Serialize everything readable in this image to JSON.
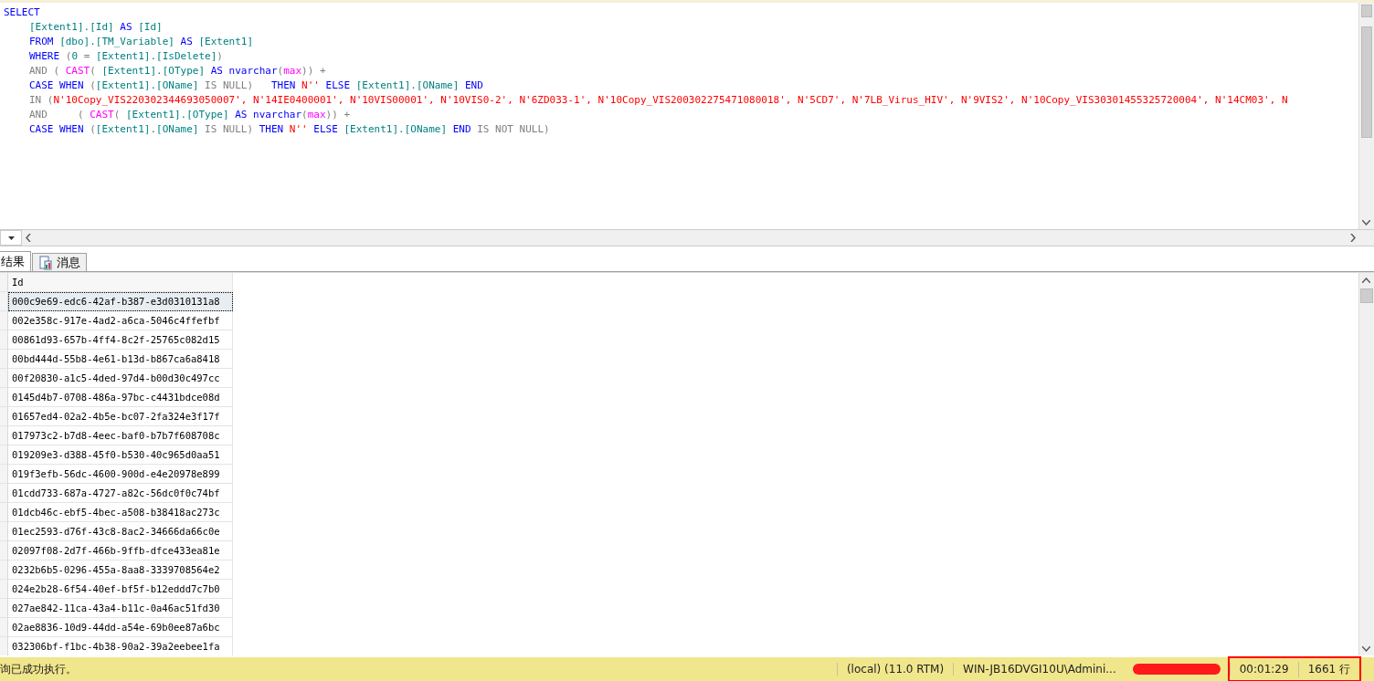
{
  "editor": {
    "lines": [
      {
        "tokens": [
          {
            "kind": "keyword",
            "text": "SELECT"
          }
        ]
      },
      {
        "tokens": [
          {
            "kind": "ident",
            "text": "[Extent1].[Id]"
          },
          {
            "kind": "keyword",
            "text": " AS "
          },
          {
            "kind": "ident",
            "text": "[Id]"
          }
        ]
      },
      {
        "tokens": [
          {
            "kind": "keyword",
            "text": "FROM "
          },
          {
            "kind": "ident",
            "text": "[dbo].[TM_Variable]"
          },
          {
            "kind": "keyword",
            "text": " AS "
          },
          {
            "kind": "ident",
            "text": "[Extent1]"
          }
        ]
      },
      {
        "tokens": [
          {
            "kind": "keyword",
            "text": "WHERE "
          },
          {
            "kind": "op",
            "text": "("
          },
          {
            "kind": "ident",
            "text": "0 "
          },
          {
            "kind": "op",
            "text": "= "
          },
          {
            "kind": "ident",
            "text": "[Extent1].[IsDelete]"
          },
          {
            "kind": "op",
            "text": ")"
          }
        ]
      },
      {
        "tokens": [
          {
            "kind": "op",
            "text": "AND ( "
          },
          {
            "kind": "func",
            "text": "CAST"
          },
          {
            "kind": "op",
            "text": "( "
          },
          {
            "kind": "ident",
            "text": "[Extent1].[OType]"
          },
          {
            "kind": "keyword",
            "text": " AS nvarchar"
          },
          {
            "kind": "op",
            "text": "("
          },
          {
            "kind": "func",
            "text": "max"
          },
          {
            "kind": "op",
            "text": ")) +"
          }
        ]
      },
      {
        "tokens": [
          {
            "kind": "keyword",
            "text": "CASE WHEN "
          },
          {
            "kind": "op",
            "text": "("
          },
          {
            "kind": "ident",
            "text": "[Extent1].[OName]"
          },
          {
            "kind": "op",
            "text": " IS NULL)   "
          },
          {
            "kind": "keyword",
            "text": "THEN "
          },
          {
            "kind": "string",
            "text": "N''"
          },
          {
            "kind": "keyword",
            "text": " ELSE "
          },
          {
            "kind": "ident",
            "text": "[Extent1].[OName]"
          },
          {
            "kind": "keyword",
            "text": " END"
          }
        ]
      },
      {
        "tokens": [
          {
            "kind": "op",
            "text": "IN ("
          },
          {
            "kind": "string",
            "text": "N'10Copy_VIS220302344693050007', N'14IE0400001', N'10VIS00001', N'10VIS0-2', N'6ZD033-1', N'10Copy_VIS200302275471080018', N'5CD7', N'7LB_Virus_HIV', N'9VIS2', N'10Copy_VIS30301455325720004', N'14CM03', N"
          }
        ]
      },
      {
        "tokens": [
          {
            "kind": "op",
            "text": "AND     ( "
          },
          {
            "kind": "func",
            "text": "CAST"
          },
          {
            "kind": "op",
            "text": "( "
          },
          {
            "kind": "ident",
            "text": "[Extent1].[OType]"
          },
          {
            "kind": "keyword",
            "text": " AS nvarchar"
          },
          {
            "kind": "op",
            "text": "("
          },
          {
            "kind": "func",
            "text": "max"
          },
          {
            "kind": "op",
            "text": ")) +"
          }
        ]
      },
      {
        "tokens": [
          {
            "kind": "keyword",
            "text": "CASE WHEN "
          },
          {
            "kind": "op",
            "text": "("
          },
          {
            "kind": "ident",
            "text": "[Extent1].[OName]"
          },
          {
            "kind": "op",
            "text": " IS NULL) "
          },
          {
            "kind": "keyword",
            "text": "THEN "
          },
          {
            "kind": "string",
            "text": "N''"
          },
          {
            "kind": "keyword",
            "text": " ELSE "
          },
          {
            "kind": "ident",
            "text": "[Extent1].[OName]"
          },
          {
            "kind": "keyword",
            "text": " END "
          },
          {
            "kind": "op",
            "text": "IS NOT NULL)"
          }
        ]
      }
    ]
  },
  "result_tabs": [
    {
      "label": "结果",
      "selected": true
    },
    {
      "label": "消息",
      "selected": false
    }
  ],
  "grid": {
    "columns": [
      "Id"
    ],
    "rows": [
      {
        "cells": [
          "000c9e69-edc6-42af-b387-e3d0310131a8"
        ],
        "selected": true
      },
      {
        "cells": [
          "002e358c-917e-4ad2-a6ca-5046c4ffefbf"
        ],
        "selected": false
      },
      {
        "cells": [
          "00861d93-657b-4ff4-8c2f-25765c082d15"
        ],
        "selected": false
      },
      {
        "cells": [
          "00bd444d-55b8-4e61-b13d-b867ca6a8418"
        ],
        "selected": false
      },
      {
        "cells": [
          "00f20830-a1c5-4ded-97d4-b00d30c497cc"
        ],
        "selected": false
      },
      {
        "cells": [
          "0145d4b7-0708-486a-97bc-c4431bdce08d"
        ],
        "selected": false
      },
      {
        "cells": [
          "01657ed4-02a2-4b5e-bc07-2fa324e3f17f"
        ],
        "selected": false
      },
      {
        "cells": [
          "017973c2-b7d8-4eec-baf0-b7b7f608708c"
        ],
        "selected": false
      },
      {
        "cells": [
          "019209e3-d388-45f0-b530-40c965d0aa51"
        ],
        "selected": false
      },
      {
        "cells": [
          "019f3efb-56dc-4600-900d-e4e20978e899"
        ],
        "selected": false
      },
      {
        "cells": [
          "01cdd733-687a-4727-a82c-56dc0f0c74bf"
        ],
        "selected": false
      },
      {
        "cells": [
          "01dcb46c-ebf5-4bec-a508-b38418ac273c"
        ],
        "selected": false
      },
      {
        "cells": [
          "01ec2593-d76f-43c8-8ac2-34666da66c0e"
        ],
        "selected": false
      },
      {
        "cells": [
          "02097f08-2d7f-466b-9ffb-dfce433ea81e"
        ],
        "selected": false
      },
      {
        "cells": [
          "0232b6b5-0296-455a-8aa8-3339708564e2"
        ],
        "selected": false
      },
      {
        "cells": [
          "024e2b28-6f54-40ef-bf5f-b12eddd7c7b0"
        ],
        "selected": false
      },
      {
        "cells": [
          "027ae842-11ca-43a4-b11c-0a46ac51fd30"
        ],
        "selected": false
      },
      {
        "cells": [
          "02ae8836-10d9-44dd-a54e-69b0ee87a6bc"
        ],
        "selected": false
      },
      {
        "cells": [
          "032306bf-f1bc-4b38-90a2-39a2eebee1fa"
        ],
        "selected": false
      }
    ]
  },
  "status_bar": {
    "message": "询已成功执行。",
    "items": [
      {
        "kind": "text",
        "text": "(local) (11.0 RTM)"
      },
      {
        "kind": "text",
        "text": "WIN-JB16DVGI10U\\Admini..."
      },
      {
        "kind": "redacted"
      },
      {
        "kind": "text",
        "text": "00:01:29",
        "highlighted": true
      },
      {
        "kind": "text",
        "text": "1661 行",
        "highlighted": true
      }
    ]
  }
}
